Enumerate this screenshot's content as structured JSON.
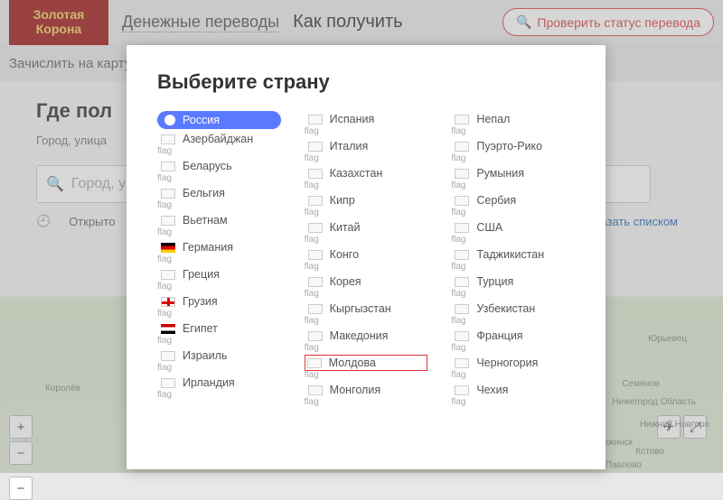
{
  "header": {
    "logo_top": "Золотая",
    "logo_bottom": "Корона",
    "nav_transfers": "Денежные переводы",
    "nav_how": "Как получить",
    "status_btn": "Проверить статус перевода"
  },
  "subheader": {
    "credit_card": "Зачислить на карту"
  },
  "page": {
    "where_title": "Где пол",
    "city_label": "Город, улица",
    "placeholder": "Город, у",
    "open_now": "Открыто",
    "show_list": "казать списком"
  },
  "modal": {
    "title": "Выберите страну",
    "flag_text": "flag",
    "col1": [
      "Россия",
      "Азербайджан",
      "Беларусь",
      "Бельгия",
      "Вьетнам",
      "Германия",
      "Греция",
      "Грузия",
      "Египет",
      "Израиль",
      "Ирландия"
    ],
    "col2": [
      "Испания",
      "Италия",
      "Казахстан",
      "Кипр",
      "Китай",
      "Конго",
      "Корея",
      "Кыргызстан",
      "Македония",
      "Молдова",
      "Монголия"
    ],
    "col3": [
      "Непал",
      "Пуэрто-Рико",
      "Румыния",
      "Сербия",
      "США",
      "Таджикистан",
      "Турция",
      "Узбекистан",
      "Франция",
      "Черногория",
      "Чехия"
    ],
    "selected": "Россия",
    "highlighted": "Молдова"
  },
  "map": {
    "labels": [
      "Королёв",
      "Юрьевец",
      "Семёнов",
      "Нижегород Область",
      "Нижний Новгоро",
      "Дзержинск",
      "Кстово",
      "Павлово"
    ]
  }
}
